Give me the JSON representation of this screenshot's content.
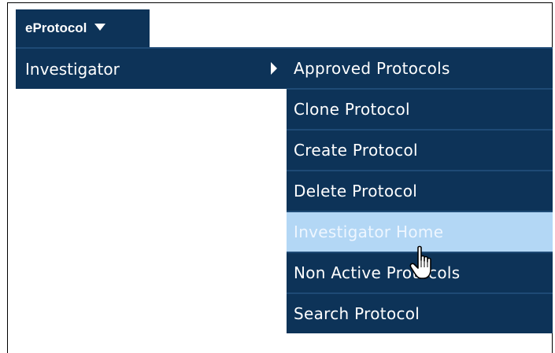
{
  "menu": {
    "root_label": "eProtocol",
    "level1_label": "Investigator",
    "submenu_items": [
      "Approved Protocols",
      "Clone Protocol",
      "Create Protocol",
      "Delete Protocol",
      "Investigator Home",
      "Non Active Protocols",
      "Search Protocol"
    ],
    "hovered_item": "Investigator Home"
  },
  "icons": {
    "root_caret": "chevron-down-icon",
    "level1_arrow": "chevron-right-icon",
    "cursor": "hand-pointer-icon"
  },
  "colors": {
    "menu_bg": "#0d3358",
    "menu_text": "#ffffff",
    "hover_bg": "#b3d7f5",
    "separator": "#1e4a75"
  }
}
